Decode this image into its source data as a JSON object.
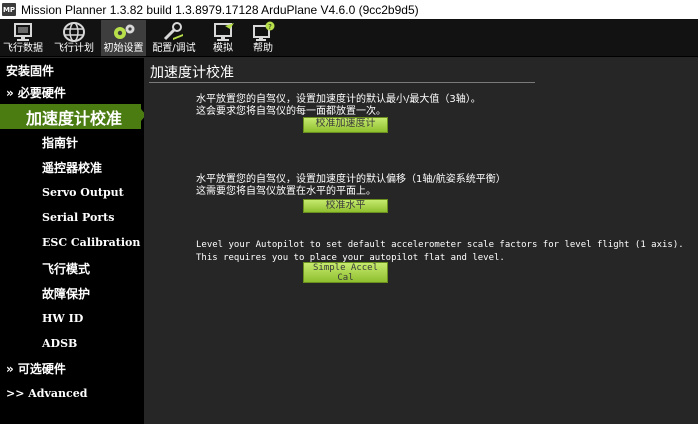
{
  "window": {
    "icon_text": "MP",
    "title": "Mission Planner 1.3.82 build 1.3.8979.17128 ArduPlane V4.6.0 (9cc2b9d5)"
  },
  "toolbar": {
    "items": [
      {
        "label": "飞行数据",
        "icon": "monitor-icon"
      },
      {
        "label": "飞行计划",
        "icon": "globe-icon"
      },
      {
        "label": "初始设置",
        "icon": "gears-icon"
      },
      {
        "label": "配置/调试",
        "icon": "wrench-plane-icon"
      },
      {
        "label": "模拟",
        "icon": "monitor-plane-icon"
      },
      {
        "label": "帮助",
        "icon": "help-monitor-icon"
      }
    ],
    "active_index": 2
  },
  "sidebar": {
    "items": [
      {
        "label": "安装固件"
      },
      {
        "label": "» 必要硬件"
      },
      {
        "label": "加速度计校准"
      },
      {
        "label": "指南针"
      },
      {
        "label": "遥控器校准"
      },
      {
        "label": "Servo Output"
      },
      {
        "label": "Serial Ports"
      },
      {
        "label": "ESC Calibration"
      },
      {
        "label": "飞行模式"
      },
      {
        "label": "故障保护"
      },
      {
        "label": "HW ID"
      },
      {
        "label": "ADSB"
      },
      {
        "label": "» 可选硬件"
      },
      {
        "label": ">> Advanced"
      }
    ],
    "active_index": 2
  },
  "main": {
    "title": "加速度计校准",
    "section1": {
      "line1": "水平放置您的自驾仪，设置加速度计的默认最小/最大值（3轴）。",
      "line2": "这会要求您将自驾仪的每一面都放置一次。",
      "button": "校准加速度计"
    },
    "section2": {
      "line1": "水平放置您的自驾仪，设置加速度计的默认偏移（1轴/航姿系统平衡）",
      "line2": "这需要您将自驾仪放置在水平的平面上。",
      "button": "校准水平"
    },
    "section3": {
      "line1": "Level your Autopilot to set default accelerometer scale factors for level flight (1 axis).",
      "line2": "This requires you to place your autopilot flat and level.",
      "button": "Simple Accel Cal"
    }
  },
  "colors": {
    "sidebar_bg": "#000000",
    "main_bg": "#262626",
    "accent_green": "#4a7c12",
    "button_green": "#a9d44a"
  }
}
